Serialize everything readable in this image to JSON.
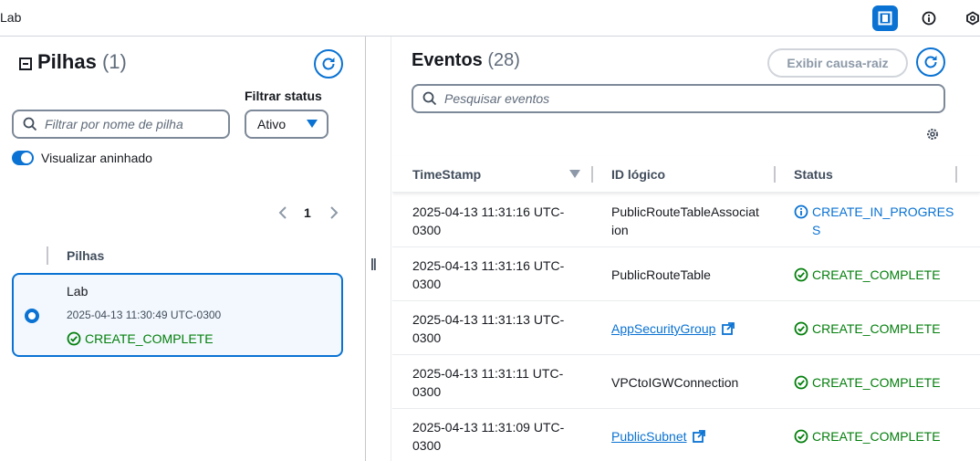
{
  "topbar": {
    "breadcrumb": "Lab",
    "icons": [
      "split-panel-icon",
      "info-icon",
      "settings-hex-icon"
    ]
  },
  "stacks": {
    "title": "Pilhas",
    "count": "(1)",
    "filter_label": "Filtrar status",
    "search_placeholder": "Filtrar por nome de pilha",
    "status_value": "Ativo",
    "toggle_label": "Visualizar aninhado",
    "page_number": "1",
    "column_header": "Pilhas",
    "items": [
      {
        "name": "Lab",
        "timestamp": "2025-04-13 11:30:49 UTC-0300",
        "status": "CREATE_COMPLETE"
      }
    ]
  },
  "events": {
    "title": "Eventos",
    "count": "(28)",
    "root_cause_button": "Exibir causa-raiz",
    "search_placeholder": "Pesquisar eventos",
    "columns": [
      "TimeStamp",
      "ID lógico",
      "Status"
    ],
    "rows": [
      {
        "ts1": "2025-04-13 11:31:16 UTC-",
        "ts2": "0300",
        "lid1": "PublicRouteTableAssociat",
        "lid2": "ion",
        "link": false,
        "st1": "CREATE_IN_PROGRES",
        "st2": "S",
        "kind": "info"
      },
      {
        "ts1": "2025-04-13 11:31:16 UTC-",
        "ts2": "0300",
        "lid1": "PublicRouteTable",
        "lid2": "",
        "link": false,
        "st1": "CREATE_COMPLETE",
        "st2": "",
        "kind": "ok"
      },
      {
        "ts1": "2025-04-13 11:31:13 UTC-",
        "ts2": "0300",
        "lid1": "AppSecurityGroup",
        "lid2": "",
        "link": true,
        "st1": "CREATE_COMPLETE",
        "st2": "",
        "kind": "ok"
      },
      {
        "ts1": "2025-04-13 11:31:11 UTC-",
        "ts2": "0300",
        "lid1": "VPCtoIGWConnection",
        "lid2": "",
        "link": false,
        "st1": "CREATE_COMPLETE",
        "st2": "",
        "kind": "ok"
      },
      {
        "ts1": "2025-04-13 11:31:09 UTC-",
        "ts2": "0300",
        "lid1": "PublicSubnet",
        "lid2": "",
        "link": true,
        "st1": "CREATE_COMPLETE",
        "st2": "",
        "kind": "ok"
      }
    ]
  },
  "colors": {
    "accent": "#0972d3",
    "success": "#037f0c",
    "border": "#7d8998"
  }
}
